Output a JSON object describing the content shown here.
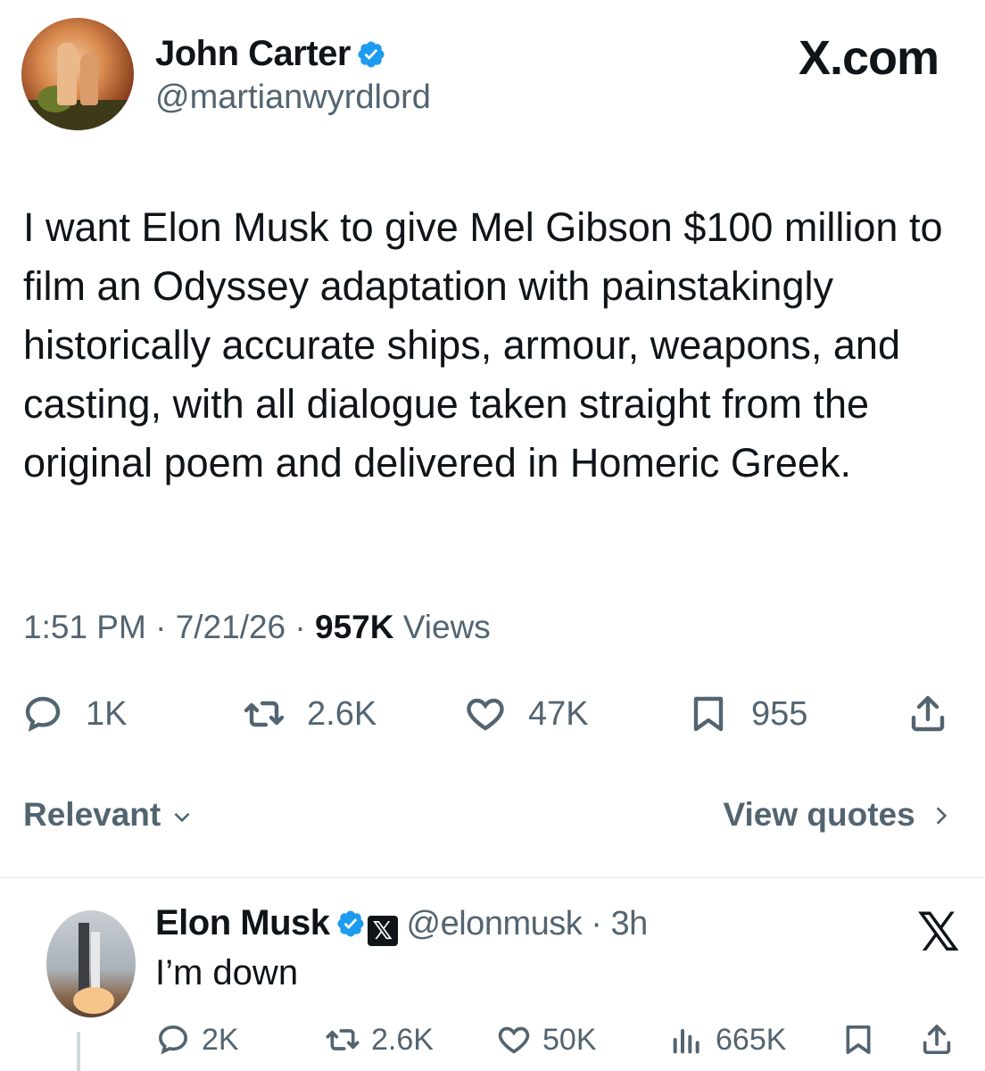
{
  "tweet": {
    "author_name": "John Carter",
    "author_handle": "@martianwyrdlord",
    "site_label": "X.com",
    "text": "I want Elon Musk to give Mel Gibson $100 million to film an Odyssey adaptation with painstakingly historically accurate ships, armour, weapons, and casting, with all dialogue taken straight from the original poem and delivered in Homeric Greek.",
    "time": "1:51 PM",
    "date": "7/21/26",
    "views_count": "957K",
    "views_label": "Views",
    "replies": "1K",
    "reposts": "2.6K",
    "likes": "47K",
    "bookmarks": "955"
  },
  "sort": {
    "relevant_label": "Relevant",
    "view_quotes_label": "View quotes"
  },
  "reply": {
    "author_name": "Elon Musk",
    "author_handle": "@elonmusk",
    "age": "3h",
    "text": "I’m down",
    "replies": "2K",
    "reposts": "2.6K",
    "likes": "50K",
    "views": "665K"
  },
  "colors": {
    "verified": "#1d9bf0",
    "muted": "#536471",
    "text": "#0f1419"
  },
  "icons": [
    "verified-icon",
    "reply-icon",
    "repost-icon",
    "like-icon",
    "bookmark-icon",
    "share-icon",
    "chevron-down-icon",
    "chevron-right-icon",
    "views-icon",
    "x-logo-icon"
  ]
}
